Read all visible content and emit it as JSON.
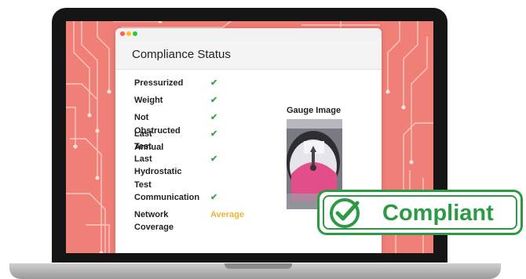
{
  "window": {
    "title": "Compliance Status"
  },
  "status_items": [
    {
      "label_lines": [
        "Pressurized"
      ],
      "status": "check"
    },
    {
      "label_lines": [
        "Weight"
      ],
      "status": "check"
    },
    {
      "label_lines": [
        "Not Obstructed"
      ],
      "status": "check"
    },
    {
      "label_lines": [
        "Last Annual",
        "Test"
      ],
      "status": "check"
    },
    {
      "label_lines": [
        "Last",
        "Hydrostatic",
        "Test"
      ],
      "status": "check"
    },
    {
      "label_lines": [
        "Communication"
      ],
      "status": "check"
    },
    {
      "label_lines": [
        "Network",
        "Coverage"
      ],
      "status": "Average"
    }
  ],
  "gauge": {
    "title": "Gauge Image"
  },
  "badge": {
    "label": "Compliant"
  },
  "colors": {
    "accent_green": "#2c9a45",
    "check_green": "#3aa655",
    "average_amber": "#f0b433",
    "screen_background": "#f07f78"
  },
  "icons": {
    "check": "check-icon",
    "badge": "check-circle-icon"
  }
}
